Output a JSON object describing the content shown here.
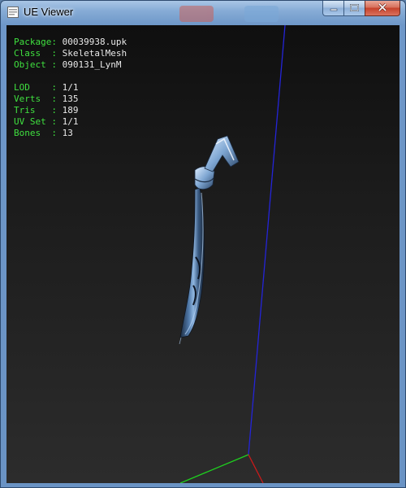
{
  "window": {
    "title": "UE Viewer",
    "controls": {
      "minimize": "minimize",
      "maximize": "maximize",
      "close": "close"
    }
  },
  "info": {
    "object_info": [
      {
        "label": "Package",
        "sep": ": ",
        "value": "00039938.upk"
      },
      {
        "label": "Class  ",
        "sep": ": ",
        "value": "SkeletalMesh"
      },
      {
        "label": "Object ",
        "sep": ": ",
        "value": "090131_LynM"
      }
    ],
    "mesh_stats": [
      {
        "label": "LOD    ",
        "sep": ": ",
        "value": "1/1"
      },
      {
        "label": "Verts  ",
        "sep": ": ",
        "value": "135"
      },
      {
        "label": "Tris   ",
        "sep": ": ",
        "value": "189"
      },
      {
        "label": "UV Set ",
        "sep": ": ",
        "value": "1/1"
      },
      {
        "label": "Bones  ",
        "sep": ": ",
        "value": "13"
      }
    ]
  },
  "colors": {
    "label_green": "#3fe03f",
    "value_white": "#e8e8e8",
    "axis_x": "#cc1a1a",
    "axis_y": "#1fcf1f",
    "axis_z": "#2424d8",
    "mesh_base": "#3c5a80",
    "mesh_highlight": "#9ec3ea"
  }
}
